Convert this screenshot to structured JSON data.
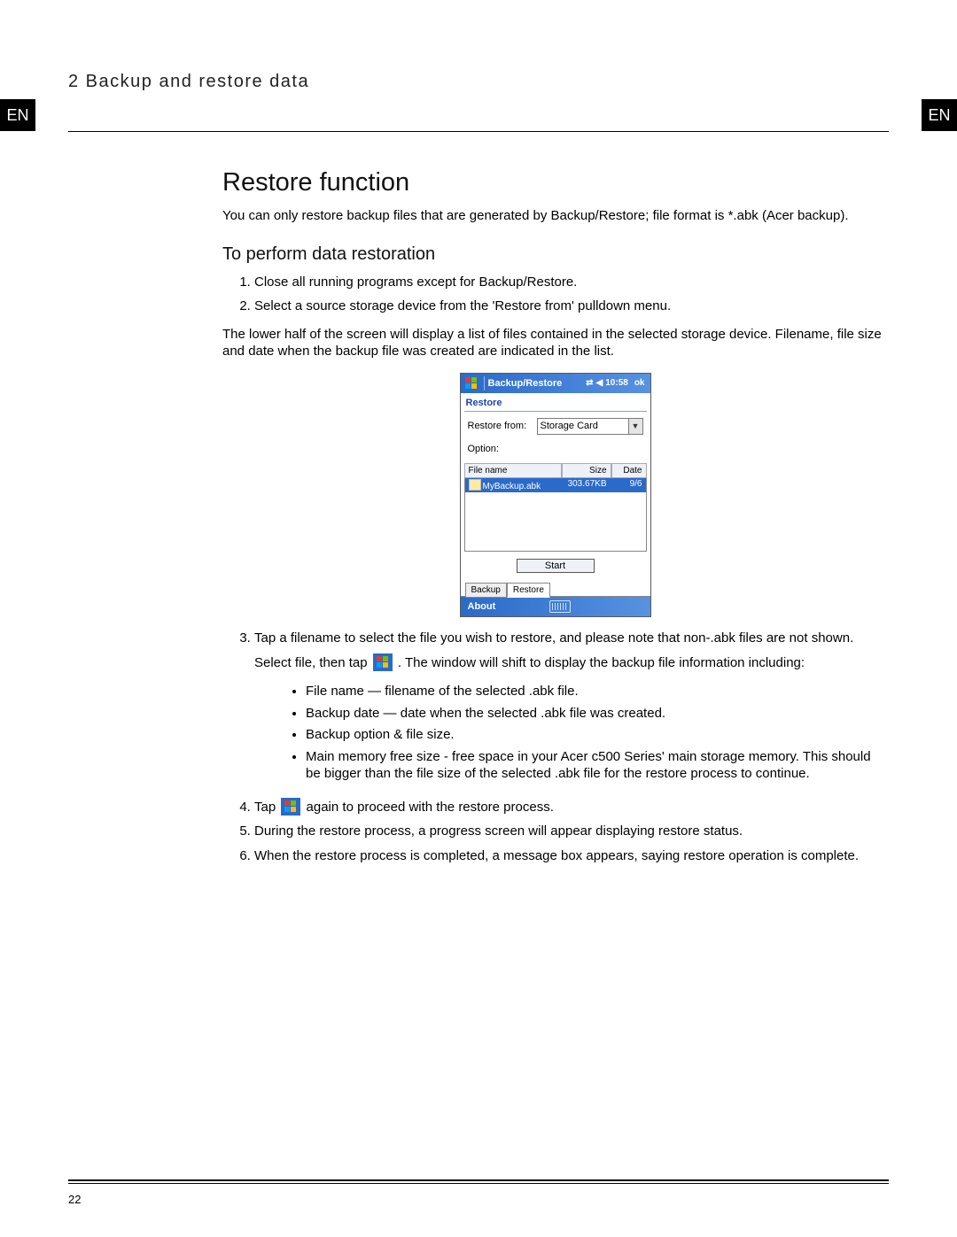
{
  "lang_tag": "EN",
  "header": "2 Backup and restore data",
  "page_number": "22",
  "section": {
    "heading": "Restore function",
    "intro": "You can only restore backup files that are generated by Backup/Restore; file format is *.abk (Acer backup).",
    "sub_heading": "To perform data restoration",
    "step1": "Close all running programs except for Backup/Restore.",
    "step2": "Select a source storage device from the 'Restore from' pulldown menu.",
    "after2": "The lower half of the screen will display a list of files contained in the selected storage device. Filename, file size and date when the backup file was created are indicated in the list.",
    "step3": "Tap a filename to select the file you wish to restore, and please note that non-.abk files are not shown.",
    "step3b_a": "Select file, then tap ",
    "step3b_b": ". The window will shift to display the backup file information including:",
    "bullets": {
      "b1": "File name — filename of the selected .abk file.",
      "b2": "Backup date — date when the selected .abk file was created.",
      "b3": "Backup option & file size.",
      "b4": "Main memory free size - free space in your Acer c500 Series' main storage memory. This should be bigger than the file size of the selected .abk file for the restore process to continue."
    },
    "step4_a": "Tap ",
    "step4_b": " again to proceed with the restore process.",
    "step5": "During the restore process, a progress screen will appear displaying restore status.",
    "step6": "When the restore process is completed, a message box appears, saying restore operation is complete."
  },
  "screenshot": {
    "title": "Backup/Restore",
    "time": "10:58",
    "ok": "ok",
    "tab_label": "Restore",
    "restore_from_label": "Restore from:",
    "restore_from_value": "Storage Card",
    "option_label": "Option:",
    "col_name": "File name",
    "col_size": "Size",
    "col_date": "Date",
    "row_name": "MyBackup.abk",
    "row_size": "303.67KB",
    "row_date": "9/6",
    "start": "Start",
    "tab_backup": "Backup",
    "tab_restore": "Restore",
    "about": "About"
  }
}
